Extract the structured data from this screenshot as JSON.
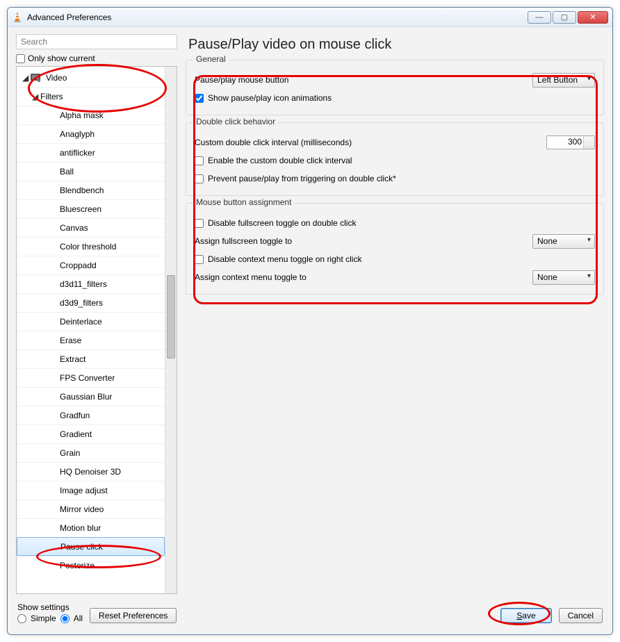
{
  "window": {
    "title": "Advanced Preferences"
  },
  "sidebar": {
    "search_placeholder": "Search",
    "only_current_label": "Only show current",
    "tree": {
      "video_label": "Video",
      "filters_label": "Filters",
      "items": [
        "Alpha mask",
        "Anaglyph",
        "antiflicker",
        "Ball",
        "Blendbench",
        "Bluescreen",
        "Canvas",
        "Color threshold",
        "Croppadd",
        "d3d11_filters",
        "d3d9_filters",
        "Deinterlace",
        "Erase",
        "Extract",
        "FPS Converter",
        "Gaussian Blur",
        "Gradfun",
        "Gradient",
        "Grain",
        "HQ Denoiser 3D",
        "Image adjust",
        "Mirror video",
        "Motion blur",
        "Pause click",
        "Posterize"
      ],
      "selected_index": 23
    }
  },
  "page": {
    "title": "Pause/Play video on mouse click"
  },
  "groups": {
    "general": {
      "legend": "General",
      "mouse_button_label": "Pause/play mouse button",
      "mouse_button_value": "Left Button",
      "show_anim_label": "Show pause/play icon animations",
      "show_anim_checked": true
    },
    "dblclick": {
      "legend": "Double click behavior",
      "interval_label": "Custom double click interval (milliseconds)",
      "interval_value": "300",
      "enable_interval_label": "Enable the custom double click interval",
      "prevent_label": "Prevent pause/play from triggering on double click*"
    },
    "assign": {
      "legend": "Mouse button assignment",
      "disable_fs_label": "Disable fullscreen toggle on double click",
      "assign_fs_label": "Assign fullscreen toggle to",
      "assign_fs_value": "None",
      "disable_ctx_label": "Disable context menu toggle on right click",
      "assign_ctx_label": "Assign context menu toggle to",
      "assign_ctx_value": "None"
    }
  },
  "bottom": {
    "show_settings_label": "Show settings",
    "simple_label": "Simple",
    "all_label": "All",
    "reset_label": "Reset Preferences",
    "save_label": "Save",
    "cancel_label": "Cancel"
  }
}
